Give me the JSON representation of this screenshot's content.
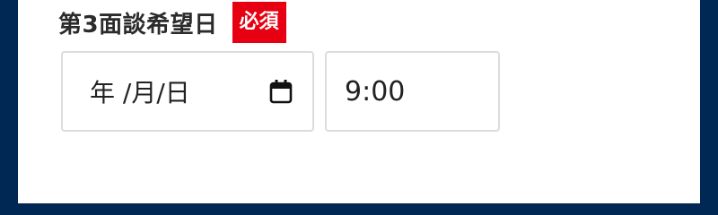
{
  "field": {
    "label": "第3面談希望日",
    "required_badge": "必須"
  },
  "date_input": {
    "display_text": "年 /月/日",
    "icon": "calendar-icon"
  },
  "time_input": {
    "value": "9:00"
  },
  "colors": {
    "frame": "#002855",
    "badge_background": "#e60012",
    "input_border": "#dcdcdc",
    "label_text": "#2b2b2b"
  }
}
